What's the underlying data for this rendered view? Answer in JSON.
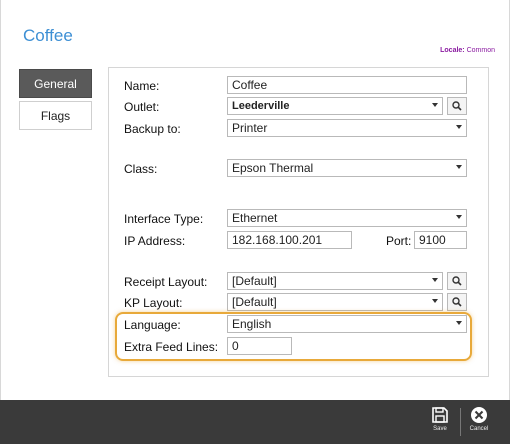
{
  "header": {
    "title": "Coffee",
    "locale_label": "Locale:",
    "locale_value": "Common"
  },
  "tabs": [
    {
      "label": "General",
      "active": true
    },
    {
      "label": "Flags",
      "active": false
    }
  ],
  "form": {
    "name": {
      "label": "Name:",
      "value": "Coffee"
    },
    "outlet": {
      "label": "Outlet:",
      "value": "Leederville"
    },
    "backup_to": {
      "label": "Backup to:",
      "value": "Printer"
    },
    "class": {
      "label": "Class:",
      "value": "Epson Thermal"
    },
    "interface_type": {
      "label": "Interface Type:",
      "value": "Ethernet"
    },
    "ip_address": {
      "label": "IP Address:",
      "value": "182.168.100.201"
    },
    "port": {
      "label": "Port:",
      "value": "9100"
    },
    "receipt_layout": {
      "label": "Receipt Layout:",
      "value": "[Default]"
    },
    "kp_layout": {
      "label": "KP Layout:",
      "value": "[Default]"
    },
    "language": {
      "label": "Language:",
      "value": "English"
    },
    "extra_feed_lines": {
      "label": "Extra Feed Lines:",
      "value": "0"
    }
  },
  "footer": {
    "save_label": "Save",
    "cancel_label": "Cancel"
  },
  "colors": {
    "title": "#3d8fd4",
    "locale": "#8a1aa0",
    "highlight": "#e8a93a",
    "tab_active_bg": "#5a5a5a",
    "footer_bg": "#3a3a3a"
  },
  "icons": {
    "search": "search-icon",
    "save": "save-icon",
    "cancel": "cancel-icon"
  }
}
